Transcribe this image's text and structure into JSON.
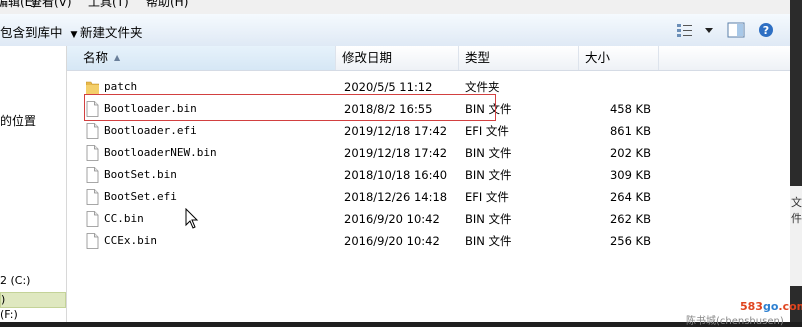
{
  "menubar": {
    "items": [
      "编辑(E)",
      "查看(V)",
      "工具(T)",
      "帮助(H)"
    ]
  },
  "toolbar": {
    "include_library_label": "包含到库中",
    "new_folder_label": "新建文件夹"
  },
  "navpane": {
    "location_text": "的位置",
    "drive_label": "2 (C:)",
    "selected_item": ")",
    "bottom_item": "(F:)"
  },
  "columns": {
    "name": "名称",
    "date": "修改日期",
    "type": "类型",
    "size": "大小"
  },
  "files": [
    {
      "name": "patch",
      "date": "2020/5/5 11:12",
      "type": "文件夹",
      "size": "",
      "icon": "folder-icon"
    },
    {
      "name": "Bootloader.bin",
      "date": "2018/8/2 16:55",
      "type": "BIN 文件",
      "size": "458 KB",
      "icon": "file-icon"
    },
    {
      "name": "Bootloader.efi",
      "date": "2019/12/18 17:42",
      "type": "EFI 文件",
      "size": "861 KB",
      "icon": "file-icon"
    },
    {
      "name": "BootloaderNEW.bin",
      "date": "2019/12/18 17:42",
      "type": "BIN 文件",
      "size": "202 KB",
      "icon": "file-icon"
    },
    {
      "name": "BootSet.bin",
      "date": "2018/10/18 16:40",
      "type": "BIN 文件",
      "size": "309 KB",
      "icon": "file-icon"
    },
    {
      "name": "BootSet.efi",
      "date": "2018/12/26 14:18",
      "type": "EFI 文件",
      "size": "264 KB",
      "icon": "file-icon"
    },
    {
      "name": "CC.bin",
      "date": "2016/9/20 10:42",
      "type": "BIN 文件",
      "size": "262 KB",
      "icon": "file-icon"
    },
    {
      "name": "CCEx.bin",
      "date": "2016/9/20 10:42",
      "type": "BIN 文件",
      "size": "256 KB",
      "icon": "file-icon"
    }
  ],
  "side_edge_text": "文件",
  "watermark": {
    "part1": "583",
    "part2": "go",
    "part3": ".com"
  },
  "footer_text": "陈书城(chenshusen)",
  "colors": {
    "highlight_border": "#d24040",
    "toolbar_bg": "#dfe9f5",
    "selected_header": "#d6e7f5"
  }
}
